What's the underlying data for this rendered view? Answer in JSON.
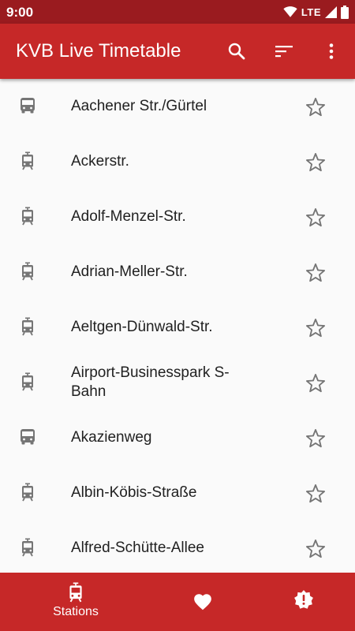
{
  "status_bar": {
    "time": "9:00",
    "network": "LTE"
  },
  "app_bar": {
    "title": "KVB Live Timetable",
    "actions": [
      "search-icon",
      "sort-icon",
      "more-vert-icon"
    ]
  },
  "colors": {
    "primary": "#c62828",
    "primary_dark": "#9a1b1f",
    "icon_grey": "#757575",
    "text": "#212121"
  },
  "stations": [
    {
      "name": "Aachener Str./Gürtel",
      "type": "bus-icon"
    },
    {
      "name": "Ackerstr.",
      "type": "tram-icon"
    },
    {
      "name": "Adolf-Menzel-Str.",
      "type": "tram-icon"
    },
    {
      "name": "Adrian-Meller-Str.",
      "type": "tram-icon"
    },
    {
      "name": "Aeltgen-Dünwald-Str.",
      "type": "tram-icon"
    },
    {
      "name": "Airport-Businesspark S-Bahn",
      "type": "tram-icon"
    },
    {
      "name": "Akazienweg",
      "type": "bus-icon"
    },
    {
      "name": "Albin-Köbis-Straße",
      "type": "tram-icon"
    },
    {
      "name": "Alfred-Schütte-Allee",
      "type": "tram-icon"
    }
  ],
  "bottom_nav": {
    "items": [
      {
        "label": "Stations",
        "icon": "tram-icon"
      },
      {
        "label": "",
        "icon": "heart-icon"
      },
      {
        "label": "",
        "icon": "alert-icon"
      }
    ]
  }
}
